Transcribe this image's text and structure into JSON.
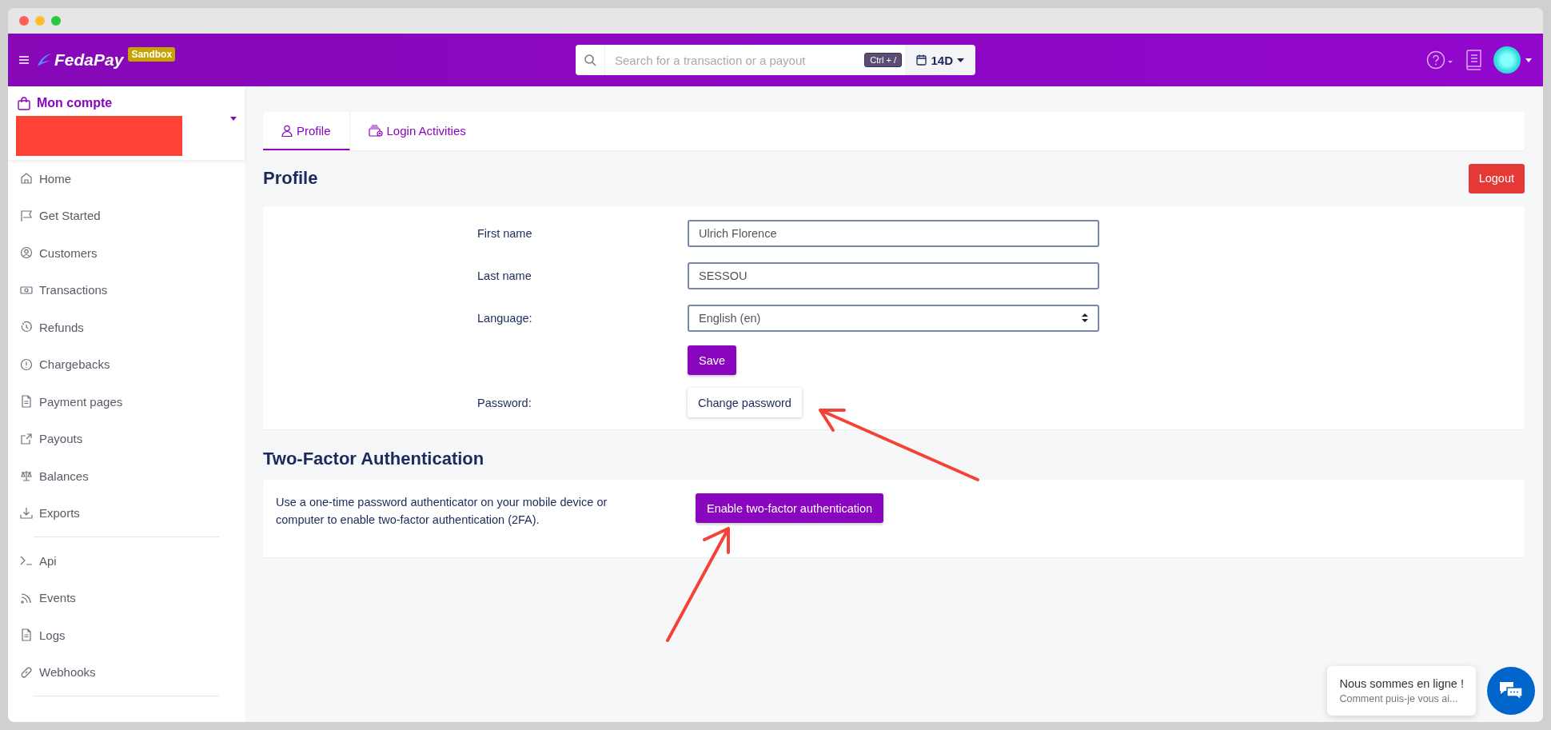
{
  "header": {
    "brand": "FedaPay",
    "badge": "Sandbox",
    "search": {
      "placeholder": "Search for a transaction or a payout",
      "shortcut": "Ctrl + /"
    },
    "period": "14D"
  },
  "sidebar": {
    "account_title": "Mon compte",
    "sections": [
      {
        "items": [
          {
            "label": "Home"
          },
          {
            "label": "Get Started"
          },
          {
            "label": "Customers"
          },
          {
            "label": "Transactions"
          },
          {
            "label": "Refunds"
          },
          {
            "label": "Chargebacks"
          },
          {
            "label": "Payment pages"
          },
          {
            "label": "Payouts"
          },
          {
            "label": "Balances"
          },
          {
            "label": "Exports"
          }
        ]
      },
      {
        "items": [
          {
            "label": "Api"
          },
          {
            "label": "Events"
          },
          {
            "label": "Logs"
          },
          {
            "label": "Webhooks"
          }
        ]
      }
    ]
  },
  "tabs": [
    {
      "label": "Profile",
      "selected": true
    },
    {
      "label": "Login Activities",
      "selected": false
    }
  ],
  "profile": {
    "title": "Profile",
    "logout": "Logout",
    "fields": [
      {
        "kind": "text",
        "label": "First name",
        "value": "Ulrich Florence"
      },
      {
        "kind": "text",
        "label": "Last name",
        "value": "SESSOU"
      },
      {
        "kind": "select",
        "label": "Language:",
        "value": "English (en)"
      }
    ],
    "save": "Save",
    "password_label": "Password:",
    "change_password": "Change password"
  },
  "two_factor": {
    "title": "Two-Factor Authentication",
    "text": "Use a one-time password authenticator on your mobile device or computer to enable two-factor authentication (2FA).",
    "button": "Enable two-factor authentication"
  },
  "chat": {
    "title": "Nous sommes en ligne !",
    "subtitle": "Comment puis-je vous ai..."
  }
}
